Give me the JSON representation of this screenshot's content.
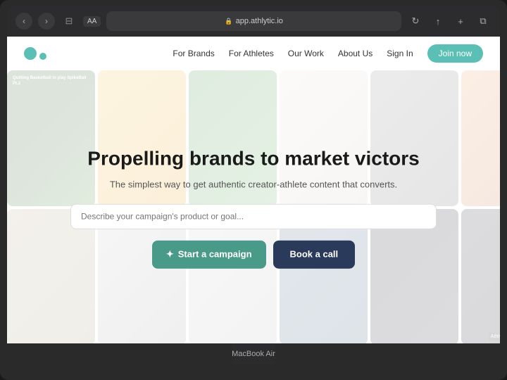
{
  "browser": {
    "url": "app.athlytic.io",
    "aa_label": "AA",
    "back_icon": "‹",
    "forward_icon": "›",
    "reader_icon": "≡≡",
    "reload_icon": "↻",
    "share_icon": "↑",
    "plus_icon": "+",
    "tabs_icon": "⧉",
    "lock_icon": "🔒"
  },
  "nav": {
    "logo_alt": "Athlytic logo",
    "links": [
      {
        "label": "For Brands",
        "id": "for-brands"
      },
      {
        "label": "For Athletes",
        "id": "for-athletes"
      },
      {
        "label": "Our Work",
        "id": "our-work"
      },
      {
        "label": "About Us",
        "id": "about-us"
      }
    ],
    "signin_label": "Sign In",
    "join_label": "Join now"
  },
  "hero": {
    "title": "Propelling brands to market victors",
    "subtitle": "The simplest way to get authentic creator-athlete content that converts.",
    "input_placeholder": "Describe your campaign's product or goal...",
    "btn_campaign_label": "Start a campaign",
    "btn_campaign_icon": "✦",
    "btn_book_label": "Book a call"
  },
  "footer": {
    "device_label": "MacBook Air"
  },
  "bg_images": [
    {
      "id": "basketball",
      "class": "img-basketball",
      "row": 1,
      "col": 1
    },
    {
      "id": "headphones",
      "class": "img-headphones",
      "row": 1,
      "col": 2
    },
    {
      "id": "green-store",
      "class": "img-green",
      "row": 1,
      "col": 3
    },
    {
      "id": "flatlay",
      "class": "img-flatlay",
      "row": 1,
      "col": 4
    },
    {
      "id": "empty-dark",
      "class": "img-empty",
      "row": 1,
      "col": 5
    },
    {
      "id": "orange-bg",
      "class": "img-orange",
      "row": 1,
      "col": 6
    },
    {
      "id": "sunglasses",
      "class": "img-sunglasses",
      "row": 2,
      "col": 1
    },
    {
      "id": "candles",
      "class": "img-candles",
      "row": 2,
      "col": 2
    },
    {
      "id": "candles2",
      "class": "img-candles",
      "row": 2,
      "col": 3
    },
    {
      "id": "outdoor",
      "class": "img-outdoor",
      "row": 2,
      "col": 4
    },
    {
      "id": "phone-dark",
      "class": "img-phone-dark",
      "row": 2,
      "col": 5
    },
    {
      "id": "sample",
      "class": "img-sample",
      "row": 2,
      "col": 6,
      "label": "Athlytic Sample"
    }
  ]
}
